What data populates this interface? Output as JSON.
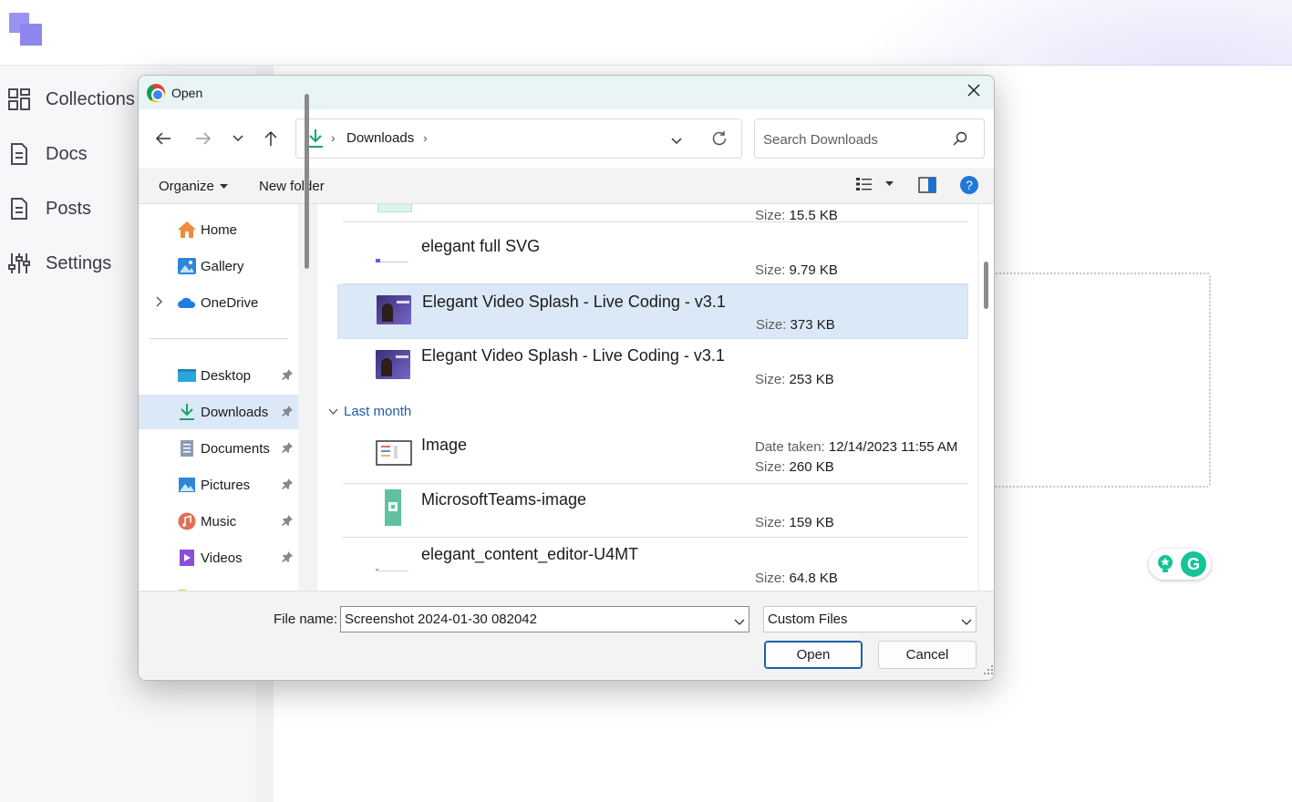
{
  "app": {
    "sidebar": {
      "items": [
        {
          "label": "Collections",
          "icon": "grid-icon"
        },
        {
          "label": "Docs",
          "icon": "document-icon"
        },
        {
          "label": "Posts",
          "icon": "document-icon"
        },
        {
          "label": "Settings",
          "icon": "sliders-icon"
        }
      ]
    }
  },
  "dialog": {
    "title": "Open",
    "address": {
      "location": "Downloads"
    },
    "search": {
      "placeholder": "Search Downloads"
    },
    "commands": {
      "organize": "Organize",
      "new_folder": "New folder"
    },
    "nav_pane": {
      "items": [
        {
          "label": "Home",
          "icon": "home-icon"
        },
        {
          "label": "Gallery",
          "icon": "gallery-icon"
        },
        {
          "label": "OneDrive",
          "icon": "cloud-icon"
        },
        {
          "label": "Desktop",
          "icon": "desktop-icon"
        },
        {
          "label": "Downloads",
          "icon": "download-icon",
          "selected": true
        },
        {
          "label": "Documents",
          "icon": "documents-icon"
        },
        {
          "label": "Pictures",
          "icon": "pictures-icon"
        },
        {
          "label": "Music",
          "icon": "music-icon"
        },
        {
          "label": "Videos",
          "icon": "videos-icon"
        }
      ]
    },
    "files": {
      "size_key": "Size:",
      "date_key": "Date taken:",
      "top_size": "15.5 KB",
      "rows": [
        {
          "name": "elegant full SVG",
          "size": "9.79 KB"
        },
        {
          "name": "Elegant Video Splash - Live Coding - v3.1",
          "size": "373 KB",
          "selected": true
        },
        {
          "name": "Elegant Video Splash - Live Coding - v3.1",
          "size": "253 KB"
        }
      ],
      "group_label": "Last month",
      "group_rows": [
        {
          "name": "Image",
          "date_taken": "12/14/2023 11:55 AM",
          "size": "260 KB"
        },
        {
          "name": "MicrosoftTeams-image",
          "size": "159 KB"
        },
        {
          "name": "elegant_content_editor-U4MT",
          "size": "64.8 KB"
        }
      ]
    },
    "bottom": {
      "file_name_label": "File name:",
      "file_name_value": "Screenshot 2024-01-30 082042",
      "file_type": "Custom Files",
      "open_label": "Open",
      "cancel_label": "Cancel"
    },
    "colors": {
      "accent": "#1f5ea8",
      "selected_bg": "#dbe8f7",
      "titlebar": "#e9f4f5"
    }
  }
}
